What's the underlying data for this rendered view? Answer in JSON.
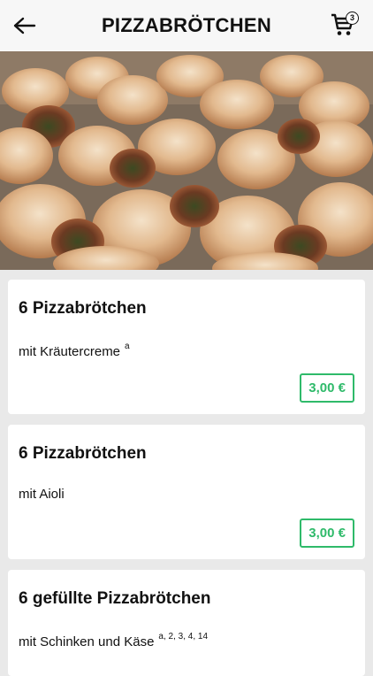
{
  "header": {
    "title": "PIZZABRÖTCHEN",
    "cart_count": "3"
  },
  "products": [
    {
      "title": "6 Pizzabrötchen",
      "description": "mit Kräutercreme",
      "superscript": "a",
      "price": "3,00 €"
    },
    {
      "title": "6 Pizzabrötchen",
      "description": "mit Aioli",
      "superscript": "",
      "price": "3,00 €"
    },
    {
      "title": "6 gefüllte Pizzabrötchen",
      "description": "mit Schinken und Käse",
      "superscript": "a, 2, 3, 4, 14",
      "price": ""
    }
  ],
  "colors": {
    "accent": "#2fba6a",
    "header_bg": "#f7f7f7",
    "page_bg": "#e9e9e9"
  }
}
